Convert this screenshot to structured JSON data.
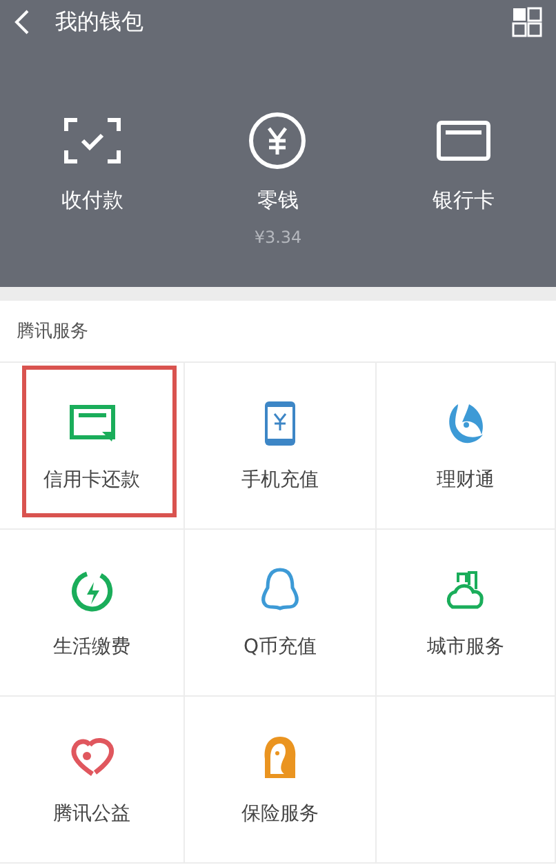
{
  "header": {
    "title": "我的钱包"
  },
  "actions": [
    {
      "label": "收付款"
    },
    {
      "label": "零钱",
      "balance": "¥3.34"
    },
    {
      "label": "银行卡"
    }
  ],
  "section": {
    "title": "腾讯服务"
  },
  "services": [
    {
      "label": "信用卡还款",
      "highlighted": true
    },
    {
      "label": "手机充值",
      "highlighted": false
    },
    {
      "label": "理财通",
      "highlighted": false
    },
    {
      "label": "生活缴费",
      "highlighted": false
    },
    {
      "label": "Q币充值",
      "highlighted": false
    },
    {
      "label": "城市服务",
      "highlighted": false
    },
    {
      "label": "腾讯公益",
      "highlighted": false
    },
    {
      "label": "保险服务",
      "highlighted": false
    }
  ]
}
